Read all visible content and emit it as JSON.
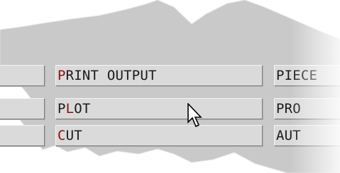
{
  "menu": {
    "rows": [
      {
        "left_stub": "",
        "main": {
          "hotkey": "P",
          "rest": "RINT OUTPUT"
        },
        "right": "PIECE"
      },
      {
        "left_stub": "",
        "main": {
          "pre": "P",
          "hotkey": "L",
          "rest": "OT"
        },
        "right": "PRO"
      },
      {
        "left_stub": "",
        "main": {
          "hotkey": "C",
          "rest": "UT"
        },
        "right": "AUT"
      }
    ]
  },
  "colors": {
    "paper_gray": "#c9c9c9",
    "button_face": "#dadada",
    "hotkey": "#8b1010",
    "text": "#1a1a1a"
  },
  "icons": {
    "cursor": "arrow-pointer-icon"
  }
}
